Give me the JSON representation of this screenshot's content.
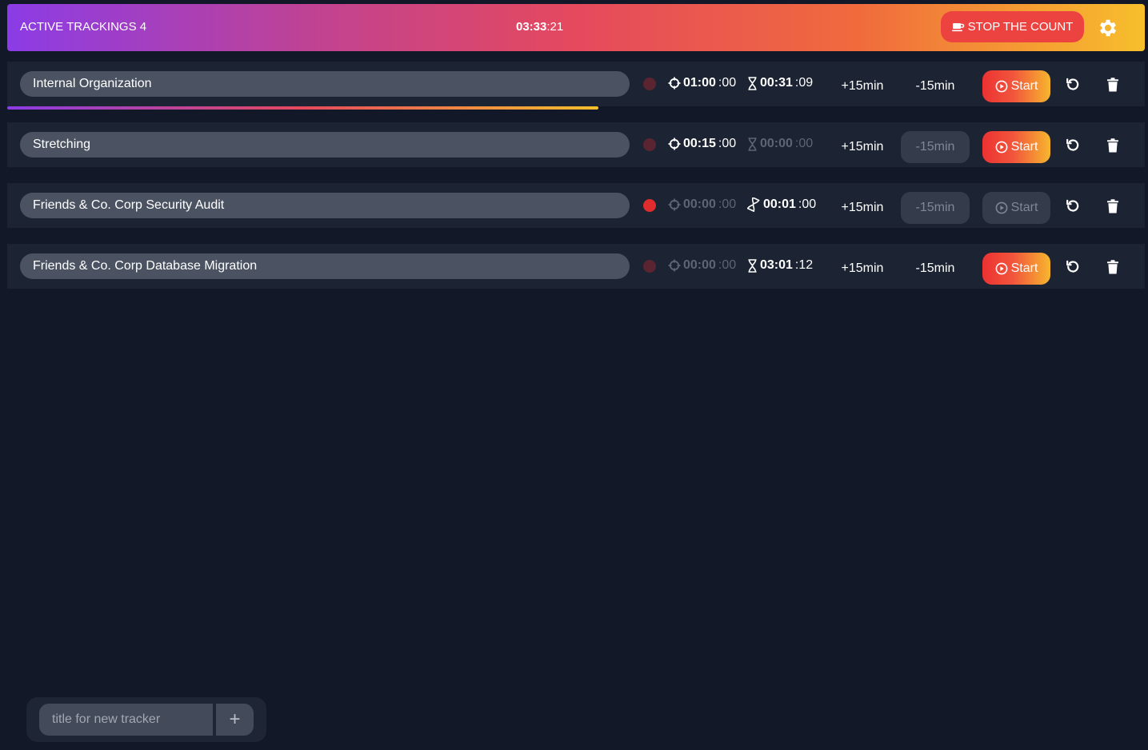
{
  "header": {
    "title": "ACTIVE TRACKINGS 4",
    "clock_hm": "03:33",
    "clock_s": ":21",
    "stop_label": "STOP THE COUNT"
  },
  "trackers": [
    {
      "title": "Internal Organization",
      "progress": 0.52,
      "target_hm": "01:00",
      "target_s": ":00",
      "elapsed_hm": "00:31",
      "elapsed_s": ":09",
      "plus_label": "+15min",
      "minus_label": "-15min",
      "start_label": "Start",
      "active": false
    },
    {
      "title": "Stretching",
      "target_hm": "00:15",
      "target_s": ":00",
      "elapsed_hm": "00:00",
      "elapsed_s": ":00",
      "plus_label": "+15min",
      "minus_label": "-15min",
      "start_label": "Start",
      "active": false
    },
    {
      "title": "Friends & Co. Corp Security Audit",
      "target_hm": "00:00",
      "target_s": ":00",
      "elapsed_hm": "00:01",
      "elapsed_s": ":00",
      "plus_label": "+15min",
      "minus_label": "-15min",
      "start_label": "Start",
      "active": true
    },
    {
      "title": "Friends & Co. Corp Database Migration",
      "target_hm": "00:00",
      "target_s": ":00",
      "elapsed_hm": "03:01",
      "elapsed_s": ":12",
      "plus_label": "+15min",
      "minus_label": "-15min",
      "start_label": "Start",
      "active": false
    }
  ],
  "new_tracker": {
    "placeholder": "title for new tracker",
    "add_label": "+"
  },
  "colors": {
    "background": "#121828",
    "row": "#1c2433",
    "accent_red": "#ec4340",
    "accent_yellow": "#f7bf2c",
    "accent_purple": "#8b3ce6"
  }
}
